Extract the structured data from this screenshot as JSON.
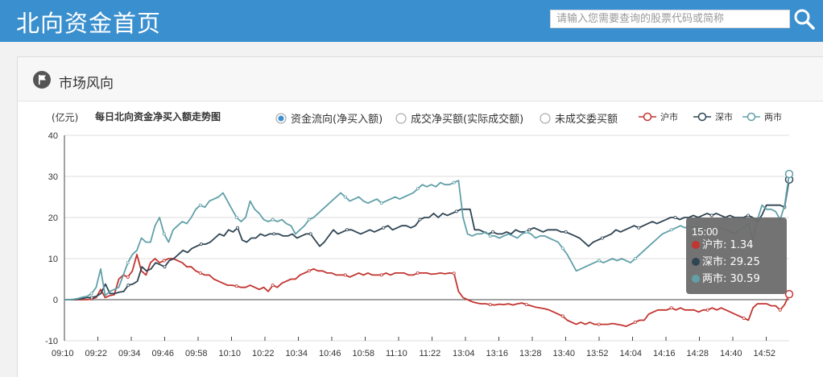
{
  "header": {
    "title": "北向资金首页",
    "search_placeholder": "请输入您需要查询的股票代码或简称"
  },
  "panel": {
    "title": "市场风向"
  },
  "chart_data": {
    "type": "line",
    "title": "每日北向资金净买入额走势图",
    "ylabel": "(亿元)",
    "ylim": [
      -10,
      40
    ],
    "yticks": [
      40,
      30,
      20,
      10,
      0,
      -10
    ],
    "x_ticks": [
      "09:10",
      "09:22",
      "09:34",
      "09:46",
      "09:58",
      "10:10",
      "10:22",
      "10:34",
      "10:46",
      "10:58",
      "11:10",
      "11:22",
      "13:04",
      "13:16",
      "13:28",
      "13:40",
      "13:52",
      "14:04",
      "14:16",
      "14:28",
      "14:40",
      "14:52"
    ],
    "modes": [
      {
        "label": "资金流向(净买入额)",
        "selected": true
      },
      {
        "label": "成交净买额(实际成交额)",
        "selected": false
      },
      {
        "label": "未成交委买额",
        "selected": false
      }
    ],
    "colors": {
      "sh": "#c23531",
      "sz": "#2f4554",
      "both": "#61a0a8"
    },
    "series": [
      {
        "name": "沪市",
        "key": "sh",
        "values": [
          0,
          0,
          0,
          0,
          0,
          0,
          0.2,
          0.5,
          2.5,
          0.5,
          1,
          1.2,
          5,
          6,
          5.5,
          7,
          11,
          7,
          6,
          9,
          10,
          9,
          9.5,
          10,
          10,
          9.5,
          9,
          8,
          8,
          7,
          6.5,
          6,
          6,
          5,
          4.5,
          4,
          3.5,
          3.5,
          3.3,
          3,
          3,
          3.5,
          3,
          2.5,
          3,
          2,
          3.5,
          3,
          4,
          4.5,
          5,
          5,
          6,
          6.5,
          7,
          7.5,
          7,
          7,
          6.5,
          6.5,
          6,
          6,
          6,
          5.5,
          6,
          6.5,
          6,
          6.5,
          6,
          6,
          6,
          6.5,
          6,
          6.5,
          6.5,
          6.5,
          6,
          6,
          6.5,
          6.5,
          6.5,
          6.2,
          6.3,
          6.5,
          6.3,
          6.5,
          6.4,
          2,
          0.5,
          0,
          -0.5,
          -0.8,
          -1,
          -1,
          -1.2,
          -1.3,
          -1.1,
          -1.2,
          -1,
          -1.3,
          -1,
          -0.8,
          -1.2,
          -1.5,
          -1.8,
          -2,
          -2.2,
          -2.5,
          -3,
          -3.5,
          -4,
          -5,
          -5.5,
          -6,
          -5.5,
          -6,
          -5.5,
          -6,
          -6,
          -6,
          -6,
          -5.8,
          -6,
          -6.2,
          -6.5,
          -6,
          -5.5,
          -5,
          -5,
          -3.5,
          -3,
          -2.5,
          -2.5,
          -2.5,
          -2,
          -2.5,
          -2,
          -2.5,
          -2.5,
          -2.5,
          -3,
          -2.5,
          -2.5,
          -2,
          -2.5,
          -2,
          -2.5,
          -3,
          -3.5,
          -4,
          -4.5,
          -5,
          -2,
          -1,
          -1,
          -1,
          -1.5,
          -1.5,
          -2.5,
          -1.2,
          1.34
        ]
      },
      {
        "name": "深市",
        "key": "sz",
        "values": [
          0,
          0,
          0,
          0.1,
          0.3,
          0.5,
          0.5,
          0.8,
          1.5,
          3.8,
          1.5,
          1.5,
          1.8,
          2,
          3.5,
          3.8,
          4.5,
          8,
          7,
          7.5,
          9,
          8.5,
          8,
          9.5,
          10,
          11,
          12,
          11.5,
          12.5,
          13,
          13.5,
          13.5,
          14,
          15,
          16,
          15.5,
          17,
          16.5,
          17.5,
          14.5,
          14,
          15,
          15,
          16,
          15.5,
          16,
          16,
          16,
          15.5,
          15.5,
          16,
          15,
          15.5,
          16,
          16,
          14.5,
          13,
          14,
          15.5,
          17,
          16,
          16.5,
          17,
          17,
          16.5,
          16,
          16.5,
          17,
          16.5,
          17,
          17.5,
          18,
          17,
          17.5,
          18,
          18,
          17.5,
          18,
          19.5,
          20,
          20,
          21,
          20,
          21,
          20.5,
          21,
          21.5,
          22,
          22,
          22,
          17,
          17,
          16.5,
          16,
          16.5,
          16,
          16,
          16.5,
          16,
          17,
          16.5,
          16.5,
          17,
          17.5,
          17,
          16.5,
          17,
          17,
          17,
          16.5,
          16.5,
          16,
          15.5,
          15,
          14,
          13,
          14,
          14.5,
          15,
          15.5,
          16,
          17,
          16.5,
          17,
          17.5,
          18,
          17.5,
          18,
          18.5,
          19,
          18.5,
          19,
          19.5,
          20,
          20,
          19.5,
          20,
          20,
          20.5,
          20,
          20.5,
          21,
          20.5,
          21,
          20.5,
          20,
          20.5,
          20,
          20,
          20,
          20.5,
          20,
          19,
          20.5,
          23,
          23,
          23,
          23,
          22.5,
          29.25
        ]
      },
      {
        "name": "两市",
        "key": "both",
        "values": [
          0,
          0,
          0.1,
          0.3,
          0.6,
          0.8,
          1.5,
          3,
          7.5,
          1,
          2,
          2.5,
          3,
          6,
          9,
          11,
          12,
          15,
          14,
          14,
          18,
          20,
          16,
          14,
          17,
          18,
          19,
          18.5,
          20,
          22,
          23,
          22.5,
          24,
          24.5,
          25,
          26,
          24,
          22,
          20,
          19,
          20,
          24,
          22,
          21,
          19.5,
          19,
          19.5,
          19,
          19.5,
          18.5,
          18,
          16,
          17,
          18,
          19.5,
          20,
          21,
          22,
          23,
          24,
          25,
          26,
          25,
          24,
          24.5,
          25,
          24,
          23.5,
          24,
          24.5,
          23.5,
          24,
          24.5,
          25,
          24.5,
          25,
          25.5,
          26,
          27,
          28,
          27.5,
          28,
          27.5,
          28.5,
          28,
          28,
          28.5,
          29,
          20,
          16,
          15.5,
          16,
          16,
          16.5,
          15.5,
          15.5,
          15,
          15.5,
          16,
          15.5,
          15,
          16,
          16.5,
          16,
          15,
          15.5,
          15.5,
          15,
          14.5,
          14,
          12.5,
          11,
          9,
          7,
          7.5,
          8,
          8.5,
          9,
          9.5,
          9,
          9.5,
          10,
          9.5,
          10,
          9.5,
          9,
          10,
          11,
          12,
          13,
          14,
          15,
          16,
          16.5,
          17,
          17.5,
          18,
          17.5,
          18,
          17.5,
          18,
          17,
          17.5,
          17,
          17,
          17.5,
          17,
          16.5,
          16,
          17,
          17.5,
          18.5,
          14.5,
          19.5,
          23,
          22,
          22,
          21.5,
          19.5,
          23,
          30.59
        ]
      }
    ],
    "tooltip": {
      "time": "15:00",
      "rows": [
        {
          "label": "沪市: 1.34",
          "color": "#c23531"
        },
        {
          "label": "深市: 29.25",
          "color": "#2f4554"
        },
        {
          "label": "两市: 30.59",
          "color": "#61a0a8"
        }
      ]
    }
  }
}
